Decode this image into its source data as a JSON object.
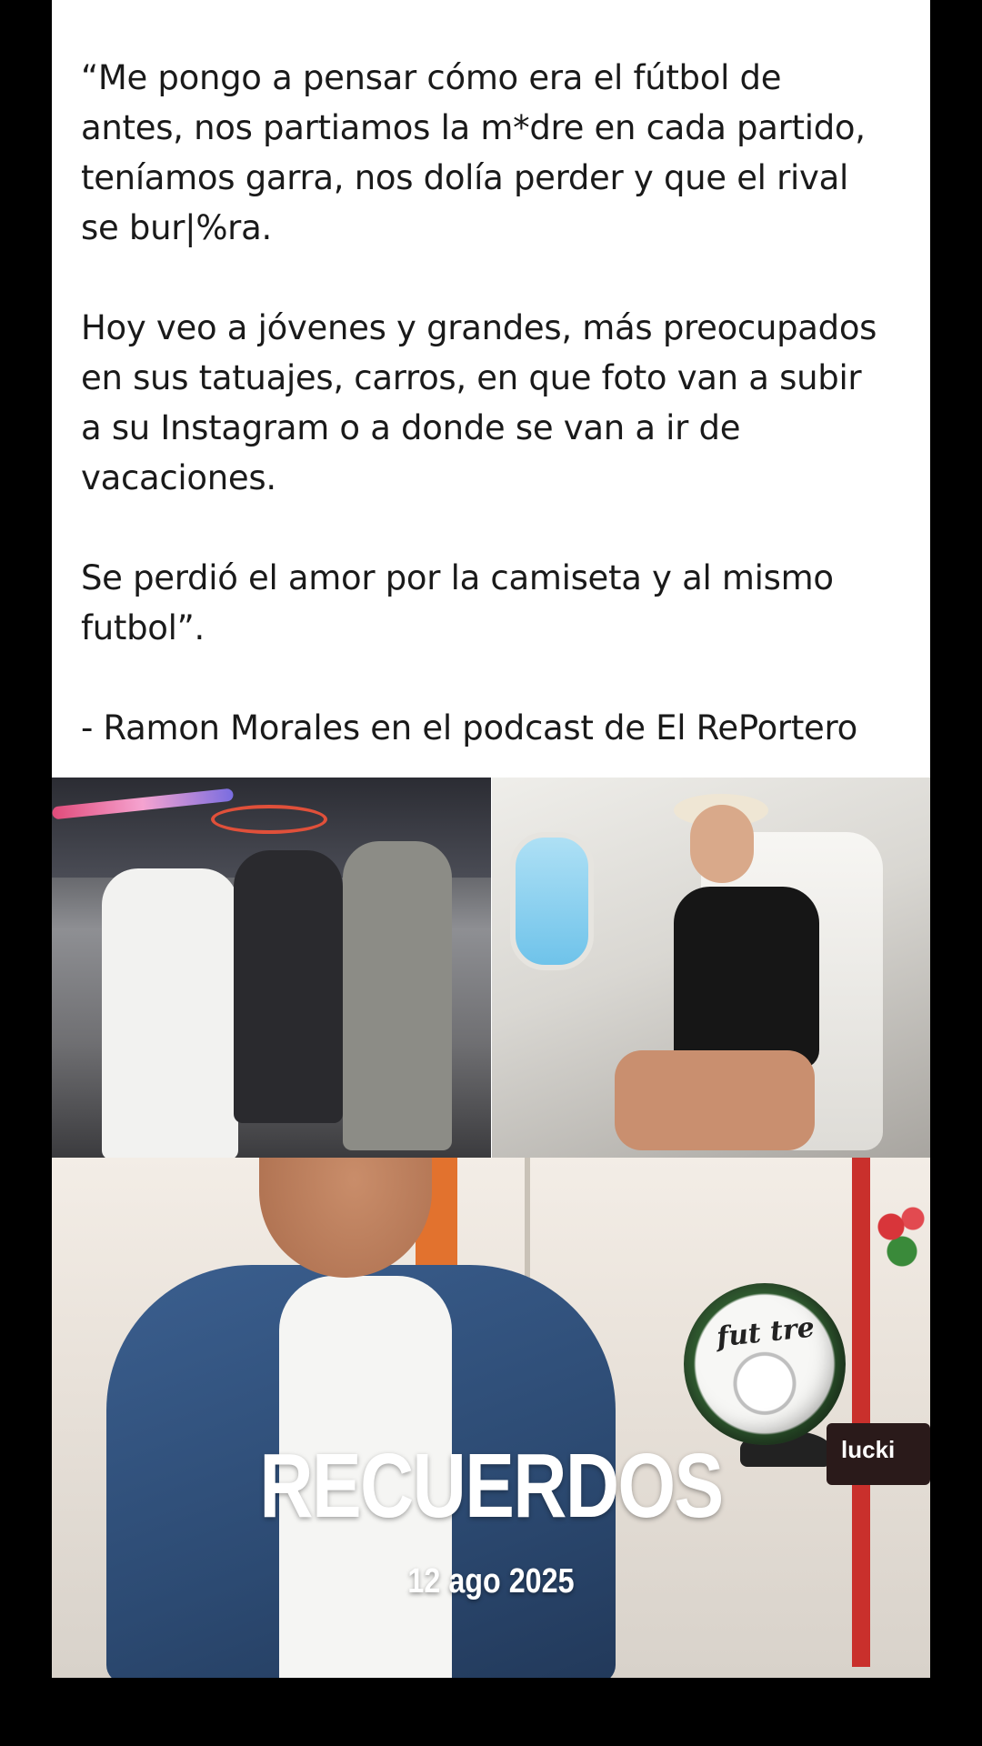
{
  "post": {
    "quote_paragraphs": [
      "“Me pongo a pensar cómo era el fútbol de\nantes, nos partiamos la m*dre en cada partido,\nteníamos garra, nos dolía perder y que el rival\nse bur|%ra.",
      "Hoy veo a jóvenes y grandes, más preocupados\nen sus tatuajes, carros, en que foto van a subir\na su Instagram o a donde se van a ir de\nvacaciones.",
      "Se perdió el amor por la camiseta y al mismo\nfutbol”.",
      "- Ramon Morales en el podcast de El RePortero"
    ]
  },
  "photos": {
    "ball_text": "fut tre",
    "logo_text": "lucki"
  },
  "overlay": {
    "title": "RECUERDOS",
    "date": "12 ago 2025"
  },
  "colors": {
    "background": "#000000",
    "card": "#ffffff",
    "text": "#1a1a1a",
    "overlay_text": "#ffffff"
  }
}
